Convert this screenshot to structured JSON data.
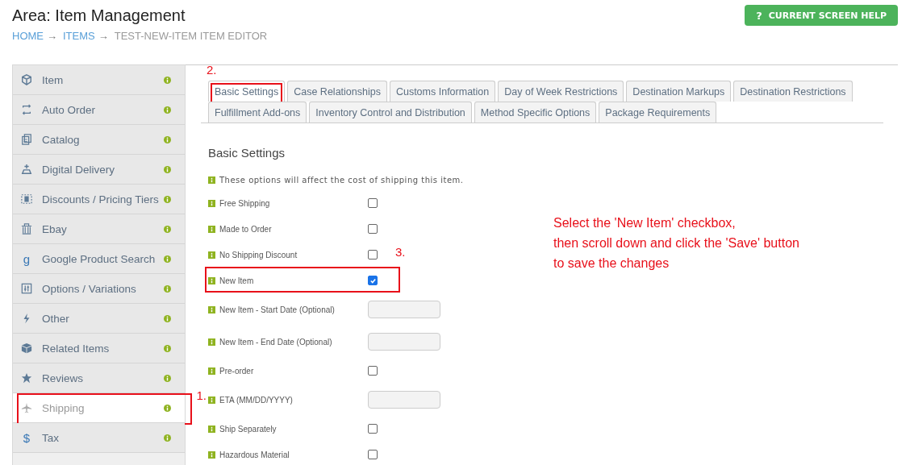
{
  "header": {
    "title": "Area: Item Management",
    "breadcrumb": [
      {
        "label": "HOME",
        "link": true
      },
      {
        "label": "ITEMS",
        "link": true
      },
      {
        "label": "TEST-NEW-ITEM ITEM EDITOR",
        "link": false
      }
    ],
    "separator": "→",
    "help_button": {
      "icon": "?",
      "label": "CURRENT SCREEN HELP"
    }
  },
  "sidebar": {
    "items": [
      {
        "label": "Item",
        "selected": false
      },
      {
        "label": "Auto Order",
        "selected": false
      },
      {
        "label": "Catalog",
        "selected": false
      },
      {
        "label": "Digital Delivery",
        "selected": false
      },
      {
        "label": "Discounts / Pricing Tiers",
        "selected": false
      },
      {
        "label": "Ebay",
        "selected": false
      },
      {
        "label": "Google Product Search",
        "selected": false,
        "glyph": "g"
      },
      {
        "label": "Options / Variations",
        "selected": false
      },
      {
        "label": "Other",
        "selected": false
      },
      {
        "label": "Related Items",
        "selected": false
      },
      {
        "label": "Reviews",
        "selected": false
      },
      {
        "label": "Shipping",
        "selected": true,
        "callout": "1."
      },
      {
        "label": "Tax",
        "selected": false,
        "glyph": "$"
      }
    ]
  },
  "tab_rows": [
    [
      {
        "label": "Basic Settings",
        "selected": true,
        "callout": "2."
      },
      {
        "label": "Case Relationships",
        "selected": false
      },
      {
        "label": "Customs Information",
        "selected": false
      },
      {
        "label": "Day of Week Restrictions",
        "selected": false
      },
      {
        "label": "Destination Markups",
        "selected": false
      },
      {
        "label": "Destination Restrictions",
        "selected": false
      }
    ],
    [
      {
        "label": "Fulfillment Add-ons",
        "selected": false
      },
      {
        "label": "Inventory Control and Distribution",
        "selected": false
      },
      {
        "label": "Method Specific Options",
        "selected": false
      },
      {
        "label": "Package Requirements",
        "selected": false
      }
    ]
  ],
  "section": {
    "title": "Basic Settings",
    "note": "These options will affect the cost of shipping this item.",
    "fields": [
      {
        "kind": "checkbox",
        "label": "Free Shipping",
        "checked": false
      },
      {
        "kind": "checkbox",
        "label": "Made to Order",
        "checked": false
      },
      {
        "kind": "checkbox",
        "label": "No Shipping Discount",
        "checked": false
      },
      {
        "kind": "checkbox",
        "label": "New Item",
        "checked": true,
        "callout": "3."
      },
      {
        "kind": "text",
        "label": "New Item - Start Date (Optional)"
      },
      {
        "kind": "text",
        "label": "New Item - End Date (Optional)"
      },
      {
        "kind": "checkbox",
        "label": "Pre-order",
        "checked": false
      },
      {
        "kind": "text",
        "label": "ETA (MM/DD/YYYY)"
      },
      {
        "kind": "checkbox",
        "label": "Ship Separately",
        "checked": false
      },
      {
        "kind": "checkbox",
        "label": "Hazardous Material",
        "checked": false
      }
    ]
  },
  "instruction": [
    "Select the 'New Item' checkbox,",
    "then scroll down and click the 'Save' button",
    "to save the changes"
  ]
}
